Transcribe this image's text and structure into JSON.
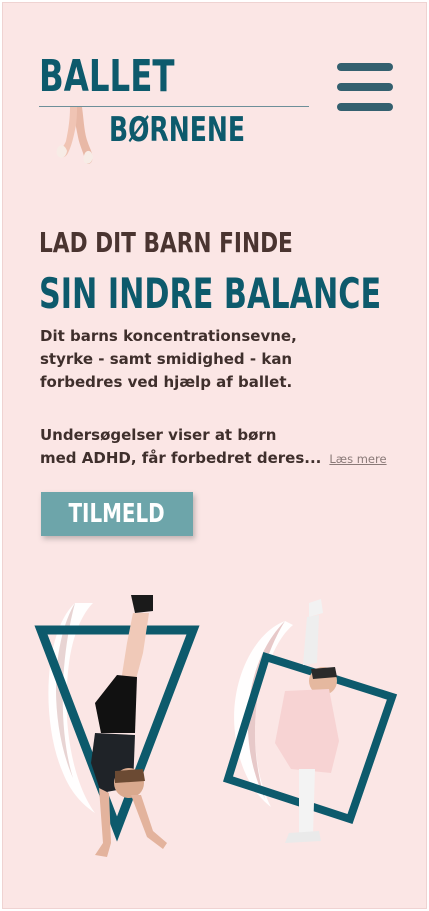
{
  "header": {
    "logo_top": "BALLET",
    "logo_bottom": "BØRNENE",
    "menu_icon": "hamburger-menu-icon"
  },
  "hero": {
    "kicker": "LAD DIT BARN FINDE",
    "title": "SIN INDRE BALANCE",
    "paragraph1_lines": [
      "Dit barns koncentrationsevne,",
      "styrke - samt smidighed - kan",
      "forbedres ved hjælp af ballet."
    ],
    "paragraph2_line1": "Undersøgelser viser at børn",
    "paragraph2_line2": "med ADHD, får forbedret deres...",
    "read_more": "Læs mere",
    "cta": "TILMELD"
  },
  "colors": {
    "background": "#fbe6e5",
    "brand": "#0d5a6c",
    "menu": "#34606f",
    "button": "#6da5aa",
    "text": "#3f2f2c"
  },
  "icons": [
    "ballet-shoes-icon",
    "hamburger-menu-icon"
  ]
}
